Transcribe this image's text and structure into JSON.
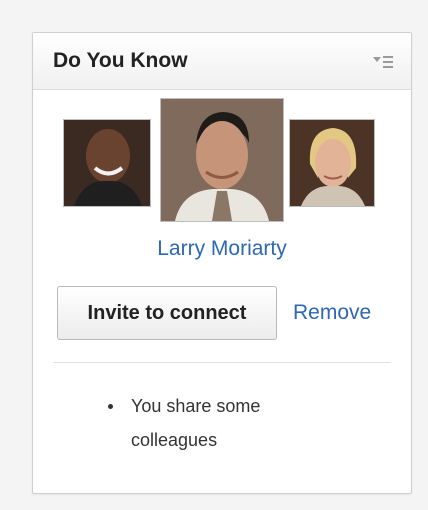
{
  "widget": {
    "title": "Do You Know",
    "menu_icon": "dropdown-menu-icon"
  },
  "suggestion": {
    "photos": [
      {
        "name": "previous-person-photo",
        "colors": {
          "skin": "#6a4330",
          "bg": "#3a2a22",
          "shirt": "#1f1f1f"
        }
      },
      {
        "name": "larry-moriarty-photo",
        "colors": {
          "skin": "#c69478",
          "bg": "#7f6a5c",
          "shirt": "#e9e6df",
          "tie": "#8b7765"
        }
      },
      {
        "name": "next-person-photo",
        "colors": {
          "skin": "#e2b396",
          "bg": "#4b3426",
          "hair": "#e3c884",
          "shirt": "#cfc3b4"
        }
      }
    ],
    "name": "Larry Moriarty",
    "invite_label": "Invite to connect",
    "remove_label": "Remove",
    "reasons": [
      "You share some colleagues"
    ]
  },
  "colors": {
    "link": "#2d67b5",
    "title": "#222222"
  }
}
